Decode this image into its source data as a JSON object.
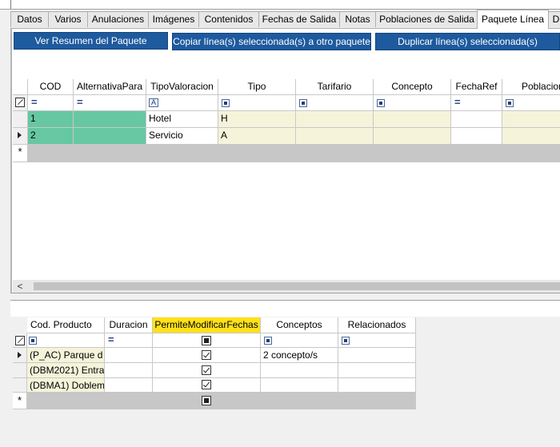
{
  "tabs": [
    {
      "label": "Datos"
    },
    {
      "label": "Varios"
    },
    {
      "label": "Anulaciones"
    },
    {
      "label": "Imágenes"
    },
    {
      "label": "Contenidos"
    },
    {
      "label": "Fechas de Salida"
    },
    {
      "label": "Notas"
    },
    {
      "label": "Poblaciones de Salida"
    },
    {
      "label": "Paquete Línea"
    },
    {
      "label": "D"
    }
  ],
  "active_tab": "Paquete Línea",
  "toolbar": {
    "summary_label": "Ver Resumen del Paquete",
    "copy_label": "Copiar línea(s) seleccionada(s) a otro paquete",
    "duplicate_label": "Duplicar línea(s) seleccionada(s)"
  },
  "upper_grid": {
    "columns": [
      "COD",
      "AlternativaPara",
      "TipoValoracion",
      "Tipo",
      "Tarifario",
      "Concepto",
      "FechaRef",
      "Poblacion"
    ],
    "filter_glyphs": [
      "equals",
      "equals",
      "text-filter",
      "box-filter",
      "box-filter",
      "box-filter",
      "equals",
      "box-filter"
    ],
    "rows": [
      {
        "COD": "1",
        "AlternativaPara": "",
        "TipoValoracion": "Hotel",
        "Tipo": "H",
        "Tarifario": "",
        "Concepto": "",
        "FechaRef": "",
        "Poblacion": ""
      },
      {
        "COD": "2",
        "AlternativaPara": "",
        "TipoValoracion": "Servicio",
        "Tipo": "A",
        "Tarifario": "",
        "Concepto": "",
        "FechaRef": "",
        "Poblacion": ""
      }
    ],
    "new_row_glyph": "*",
    "current_row_glyph": "row-pointer",
    "scroll_left_glyph": "<"
  },
  "lower_grid": {
    "columns": [
      "Cod. Producto",
      "Duracion",
      "PermiteModificarFechas",
      "Conceptos",
      "Relacionados"
    ],
    "highlighted_column": "PermiteModificarFechas",
    "rows": [
      {
        "producto": "(P_AC) Parque d",
        "duracion": "",
        "permite": true,
        "conceptos": "2 concepto/s",
        "relacionados": ""
      },
      {
        "producto": "(DBM2021) Entra",
        "duracion": "",
        "permite": true,
        "conceptos": "",
        "relacionados": ""
      },
      {
        "producto": "(DBMA1) Doblem",
        "duracion": "",
        "permite": true,
        "conceptos": "",
        "relacionados": ""
      }
    ],
    "new_row_glyph": "*"
  },
  "colors": {
    "button_bg": "#1e5a9e",
    "teal_cell": "#66c7a3",
    "beige_cell": "#f5f4da",
    "header_highlight": "#ffe11a",
    "new_row_bg": "#c7c7c7"
  }
}
